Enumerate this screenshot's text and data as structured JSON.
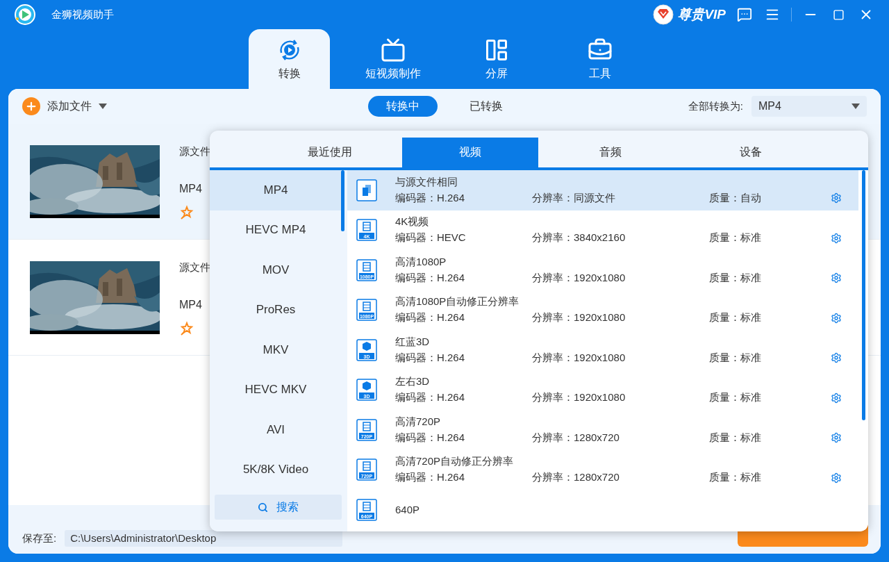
{
  "app": {
    "title": "金狮视频助手",
    "vip_label": "尊贵VIP"
  },
  "nav_tabs": [
    {
      "kind": "convert",
      "label": "转换",
      "selected": true
    },
    {
      "kind": "tv",
      "label": "短视频制作",
      "selected": false
    },
    {
      "kind": "split",
      "label": "分屏",
      "selected": false
    },
    {
      "kind": "tools",
      "label": "工具",
      "selected": false
    }
  ],
  "toolbar": {
    "add_label": "添加文件",
    "view_tabs": [
      {
        "label": "转换中",
        "selected": true
      },
      {
        "label": "已转换",
        "selected": false
      }
    ],
    "convert_all_label": "全部转换为:",
    "convert_all_value": "MP4"
  },
  "files": [
    {
      "name_label": "源文件",
      "format": "MP4",
      "selected": true
    },
    {
      "name_label": "源文件",
      "format": "MP4",
      "selected": false
    }
  ],
  "format_popup": {
    "tabs": [
      {
        "label": "最近使用",
        "selected": false
      },
      {
        "label": "视频",
        "selected": true
      },
      {
        "label": "音频",
        "selected": false
      },
      {
        "label": "设备",
        "selected": false
      }
    ],
    "categories": [
      {
        "label": "MP4",
        "selected": true
      },
      {
        "label": "HEVC MP4",
        "selected": false
      },
      {
        "label": "MOV",
        "selected": false
      },
      {
        "label": "ProRes",
        "selected": false
      },
      {
        "label": "MKV",
        "selected": false
      },
      {
        "label": "HEVC MKV",
        "selected": false
      },
      {
        "label": "AVI",
        "selected": false
      },
      {
        "label": "5K/8K Video",
        "selected": false
      }
    ],
    "search_label": "搜索",
    "presets": [
      {
        "kind": "copy",
        "title": "与源文件相同",
        "codec": "编码器：H.264",
        "resolution": "分辨率：同源文件",
        "quality": "质量：自动",
        "selected": true
      },
      {
        "kind": "film",
        "badge": "4K",
        "title": "4K视频",
        "codec": "编码器：HEVC",
        "resolution": "分辨率：3840x2160",
        "quality": "质量：标准",
        "selected": false
      },
      {
        "kind": "film",
        "badge": "1080P",
        "title": "高清1080P",
        "codec": "编码器：H.264",
        "resolution": "分辨率：1920x1080",
        "quality": "质量：标准",
        "selected": false
      },
      {
        "kind": "film",
        "badge": "1080P",
        "title": "高清1080P自动修正分辨率",
        "codec": "编码器：H.264",
        "resolution": "分辨率：1920x1080",
        "quality": "质量：标准",
        "selected": false
      },
      {
        "kind": "cube",
        "badge": "3D",
        "title": "红蓝3D",
        "codec": "编码器：H.264",
        "resolution": "分辨率：1920x1080",
        "quality": "质量：标准",
        "selected": false
      },
      {
        "kind": "cube",
        "badge": "3D",
        "title": "左右3D",
        "codec": "编码器：H.264",
        "resolution": "分辨率：1920x1080",
        "quality": "质量：标准",
        "selected": false
      },
      {
        "kind": "film",
        "badge": "720P",
        "title": "高清720P",
        "codec": "编码器：H.264",
        "resolution": "分辨率：1280x720",
        "quality": "质量：标准",
        "selected": false
      },
      {
        "kind": "film",
        "badge": "720P",
        "title": "高清720P自动修正分辨率",
        "codec": "编码器：H.264",
        "resolution": "分辨率：1280x720",
        "quality": "质量：标准",
        "selected": false
      },
      {
        "kind": "film",
        "badge": "640P",
        "title": "640P",
        "selected": false
      }
    ]
  },
  "save_bar": {
    "label": "保存至:",
    "path": "C:\\Users\\Administrator\\Desktop"
  }
}
